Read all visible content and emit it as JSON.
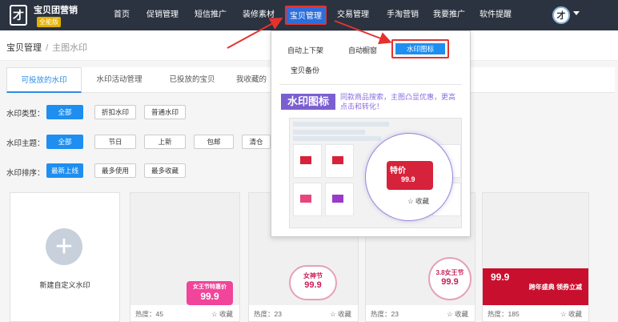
{
  "header": {
    "brand": "宝贝团营销",
    "brand_badge": "全能版",
    "logo_glyph": "才",
    "nav": [
      {
        "label": "首页"
      },
      {
        "label": "促销管理"
      },
      {
        "label": "短信推广"
      },
      {
        "label": "装修素材"
      },
      {
        "label": "宝贝管理"
      },
      {
        "label": "交易管理"
      },
      {
        "label": "手淘营销"
      },
      {
        "label": "我要推广"
      },
      {
        "label": "软件提醒"
      }
    ],
    "avatar_glyph": "才"
  },
  "breadcrumb": {
    "root": "宝贝管理",
    "sep": "/",
    "current": "主图水印"
  },
  "tabs": [
    {
      "label": "可投放的水印"
    },
    {
      "label": "水印活动管理"
    },
    {
      "label": "已投放的宝贝"
    },
    {
      "label": "我收藏的"
    }
  ],
  "filters": {
    "type_label": "水印类型：",
    "type_options": [
      "全部",
      "折扣水印",
      "普通水印"
    ],
    "theme_label": "水印主题：",
    "theme_options": [
      "全部",
      "节日",
      "上新",
      "包邮",
      "清仓"
    ],
    "sort_label": "水印排序：",
    "sort_options": [
      "最新上线",
      "最多使用",
      "最多收藏"
    ]
  },
  "cards": {
    "new_label": "新建自定义水印",
    "plus_glyph": "+",
    "items": [
      {
        "hot": "热度：45",
        "fav": "收藏",
        "sticker_top": "女王节特惠价",
        "sticker_price": "99.9"
      },
      {
        "hot": "热度：23",
        "fav": "收藏",
        "sticker_top": "女神节",
        "sticker_price": "99.9"
      },
      {
        "hot": "热度：23",
        "fav": "收藏",
        "sticker_top": "3.8女王节",
        "sticker_price": "99.9"
      },
      {
        "hot": "热度：185",
        "fav": "收藏",
        "sticker_top": "跨年盛典 领券立减",
        "sticker_price": "99.9"
      }
    ]
  },
  "dropdown": {
    "items": [
      "自动上下架",
      "自动橱窗",
      "水印图标",
      "宝贝备份"
    ],
    "banner_tag": "水印图标",
    "banner_text": "同款商品搜索，主图凸显优惠，更高点击和转化！",
    "preview_sticker": "特价",
    "preview_price": "99.9",
    "preview_fav": "收藏"
  },
  "colors": {
    "topbar": "#2b3340",
    "accent": "#1e8ef0",
    "highlight": "#e5322e",
    "banner": "#7b5fd0"
  }
}
